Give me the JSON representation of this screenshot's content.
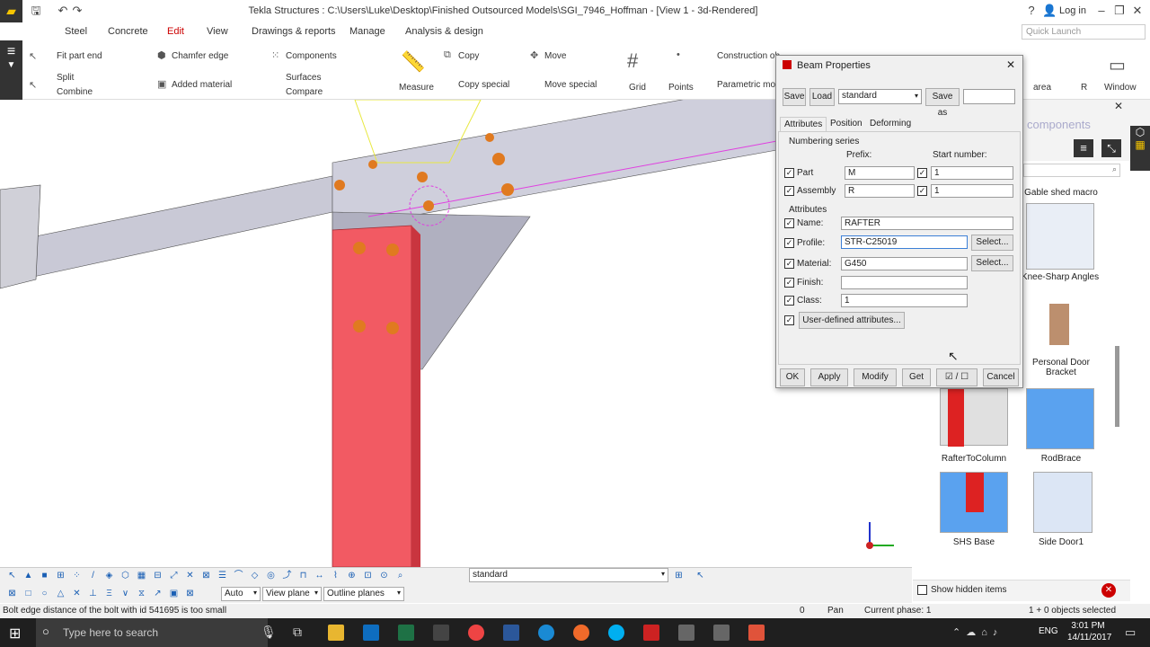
{
  "window": {
    "title": "Tekla Structures : C:\\Users\\Luke\\Desktop\\Finished Outsourced Models\\SGI_7946_Hoffman  - [View 1 - 3d-Rendered]",
    "help": "?",
    "login": "Log in",
    "min": "–",
    "restore": "❐",
    "close": "✕"
  },
  "menu": {
    "items": [
      "Steel",
      "Concrete",
      "Edit",
      "View",
      "Drawings & reports",
      "Manage",
      "Analysis & design"
    ],
    "active": "Edit",
    "search_placeholder": "Quick Launch"
  },
  "ribbon": {
    "fit_part_end": "Fit part end",
    "split": "Split",
    "combine": "Combine",
    "chamfer_edge": "Chamfer edge",
    "added_material": "Added material",
    "components": "Components",
    "surfaces": "Surfaces",
    "compare": "Compare",
    "measure": "Measure",
    "copy": "Copy",
    "copy_special": "Copy special",
    "move": "Move",
    "move_special": "Move special",
    "grid": "Grid",
    "points": "Points",
    "construction": "Construction ob",
    "parametric": "Parametric modi",
    "area": "area",
    "r_label": "R",
    "window": "Window"
  },
  "side_panel": {
    "title": "components",
    "items": [
      {
        "label": "Gable shed macro"
      },
      {
        "label": "Knee-Sharp Angles"
      },
      {
        "label": "Personal Door Bracket"
      },
      {
        "label": "RafterToColumn"
      },
      {
        "label": "RodBrace"
      },
      {
        "label": "SHS Base"
      },
      {
        "label": "Side Door1"
      }
    ],
    "show_hidden": "Show hidden items"
  },
  "dialog": {
    "title": "Beam Properties",
    "save": "Save",
    "load": "Load",
    "preset": "standard",
    "save_as": "Save as",
    "save_as_value": "",
    "tabs": [
      "Attributes",
      "Position",
      "Deforming"
    ],
    "numbering_series": "Numbering series",
    "prefix": "Prefix:",
    "start_number": "Start number:",
    "part_label": "Part",
    "part_prefix": "M",
    "part_start": "1",
    "assembly_label": "Assembly",
    "assembly_prefix": "R",
    "assembly_start": "1",
    "attributes_header": "Attributes",
    "name_label": "Name:",
    "name_value": "RAFTER",
    "profile_label": "Profile:",
    "profile_value": "STR-C25019",
    "material_label": "Material:",
    "material_value": "G450",
    "finish_label": "Finish:",
    "finish_value": "",
    "class_label": "Class:",
    "class_value": "1",
    "select": "Select...",
    "user_defined": "User-defined attributes...",
    "ok": "OK",
    "apply": "Apply",
    "modify": "Modify",
    "get": "Get",
    "toggle": "☑ / ☐",
    "cancel": "Cancel"
  },
  "bottom_toolbar": {
    "view_preset": "standard",
    "snap_auto": "Auto",
    "view_plane": "View plane",
    "outline_planes": "Outline planes"
  },
  "status": {
    "message": "Bolt edge distance of the bolt with id 541695 is too small",
    "count": "0",
    "mode": "Pan",
    "phase": "Current phase: 1",
    "selected": "1 + 0 objects selected"
  },
  "taskbar": {
    "search": "Type here to search",
    "lang": "ENG",
    "time": "3:01 PM",
    "date": "14/11/2017"
  },
  "colors": {
    "column": "#f25a63",
    "beam": "#c9c9d6",
    "accent": "#f5c400"
  }
}
